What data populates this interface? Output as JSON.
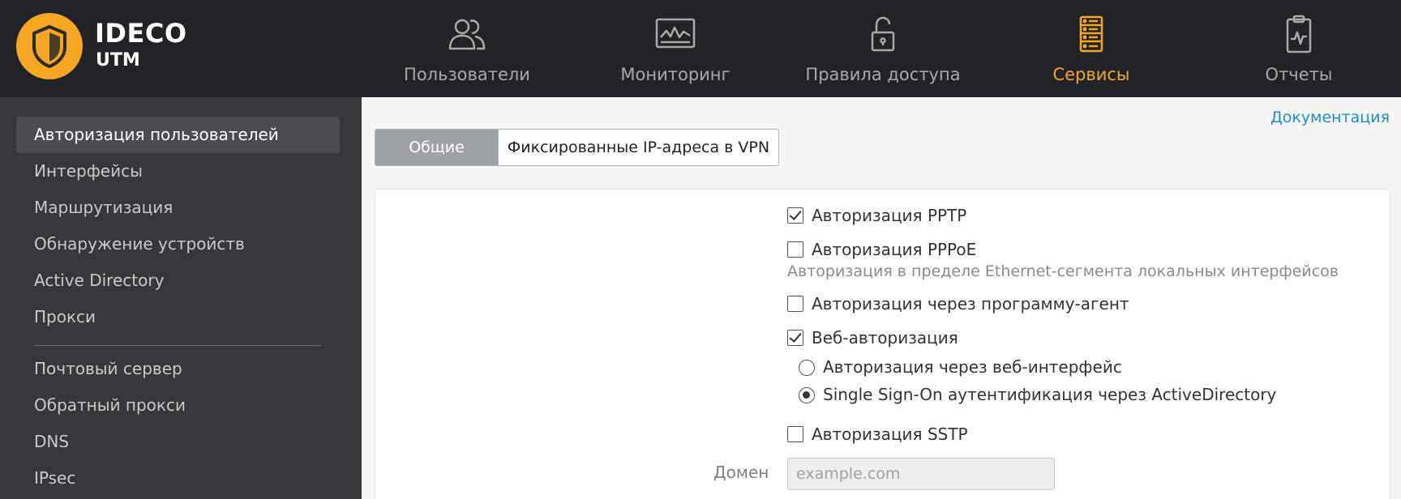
{
  "brand": {
    "name": "IDECO",
    "sub": "UTM"
  },
  "nav": {
    "items": [
      {
        "label": "Пользователи",
        "icon": "users-icon"
      },
      {
        "label": "Мониторинг",
        "icon": "monitoring-icon"
      },
      {
        "label": "Правила доступа",
        "icon": "lock-open-icon"
      },
      {
        "label": "Сервисы",
        "icon": "services-icon",
        "active": true
      },
      {
        "label": "Отчеты",
        "icon": "reports-icon"
      }
    ],
    "active_color": "#f5a623",
    "inactive_color": "#a8a9ab"
  },
  "sidebar": {
    "items": [
      {
        "label": "Авторизация пользователей",
        "active": true
      },
      {
        "label": "Интерфейсы"
      },
      {
        "label": "Маршрутизация"
      },
      {
        "label": "Обнаружение устройств"
      },
      {
        "label": "Active Directory"
      },
      {
        "label": "Прокси"
      },
      {
        "label": "Почтовый сервер"
      },
      {
        "label": "Обратный прокси"
      },
      {
        "label": "DNS"
      },
      {
        "label": "IPsec"
      }
    ]
  },
  "main": {
    "doc_link": "Документация",
    "tabs": [
      {
        "label": "Общие",
        "active": true
      },
      {
        "label": "Фиксированные IP-адреса в VPN"
      }
    ],
    "options": {
      "pptp": {
        "label": "Авторизация PPTP",
        "checked": true
      },
      "pppoe": {
        "label": "Авторизация PPPoE",
        "checked": false,
        "hint": "Авторизация в пределе Ethernet-сегмента локальных интерфейсов"
      },
      "agent": {
        "label": "Авторизация через программу-агент",
        "checked": false
      },
      "web": {
        "label": "Веб-авторизация",
        "checked": true
      },
      "web_mode": [
        {
          "label": "Авторизация через веб-интерфейс",
          "selected": false
        },
        {
          "label": "Single Sign-On аутентификация через ActiveDirectory",
          "selected": true
        }
      ],
      "sstp": {
        "label": "Авторизация SSTP",
        "checked": false
      }
    },
    "domain": {
      "label": "Домен",
      "value": "",
      "placeholder": "example.com"
    }
  },
  "colors": {
    "topbar": "#222326",
    "sidebar": "#36383c",
    "accent": "#f5a623",
    "link": "#1c8fc4"
  }
}
